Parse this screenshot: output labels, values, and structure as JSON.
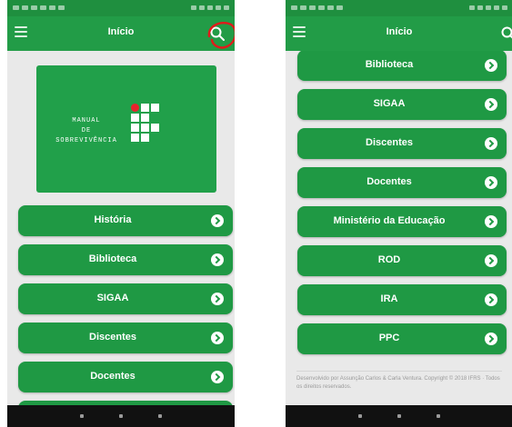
{
  "left_screen": {
    "appbar": {
      "title": "Início"
    },
    "banner": {
      "lines": [
        "MANUAL",
        "DE",
        "SOBREVIVÊNCIA"
      ]
    },
    "buttons": [
      {
        "label": "História"
      },
      {
        "label": "Biblioteca"
      },
      {
        "label": "SIGAA"
      },
      {
        "label": "Discentes"
      },
      {
        "label": "Docentes"
      }
    ]
  },
  "right_screen": {
    "appbar": {
      "title": "Início"
    },
    "buttons": [
      {
        "label": "Biblioteca"
      },
      {
        "label": "SIGAA"
      },
      {
        "label": "Discentes"
      },
      {
        "label": "Docentes"
      },
      {
        "label": "Ministério da Educação"
      },
      {
        "label": "ROD"
      },
      {
        "label": "IRA"
      },
      {
        "label": "PPC"
      }
    ],
    "footer": "Desenvolvido por Assunção Carlos & Carla Ventura. Copyright © 2018 IFRS · Todos os direitos reservados."
  },
  "colors": {
    "primary": "#229c47",
    "status_bar": "#1f8f3f",
    "annotation": "#e01b1b"
  },
  "icons": [
    "menu-icon",
    "search-icon",
    "chevron-right-icon"
  ]
}
